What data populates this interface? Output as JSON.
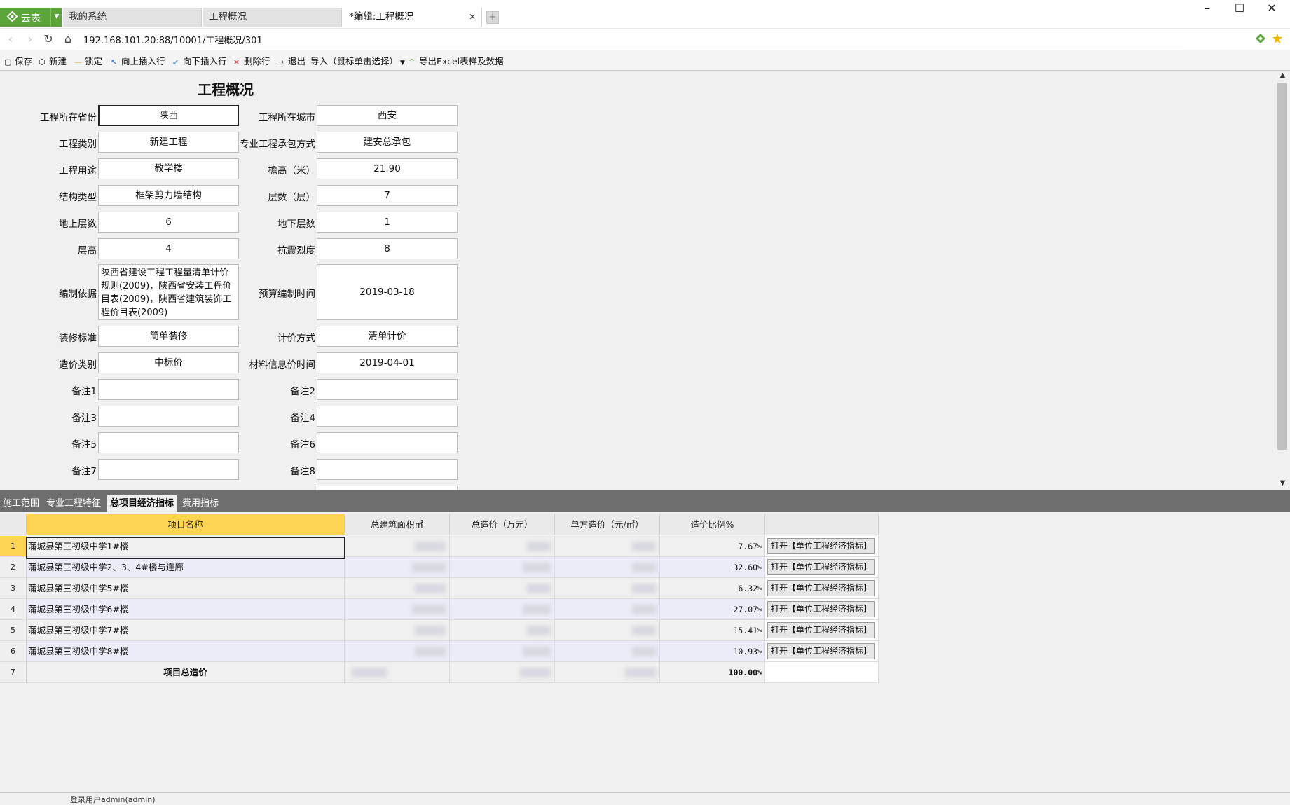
{
  "browser": {
    "brand_label": "云表",
    "tabs": [
      {
        "label": "我的系统"
      },
      {
        "label": "工程概况"
      },
      {
        "label": "*编辑:工程概况"
      }
    ],
    "url": "192.168.101.20:88/10001/工程概况/301"
  },
  "toolbar": {
    "items": [
      {
        "label": "保存"
      },
      {
        "label": "新建"
      },
      {
        "label": "锁定"
      },
      {
        "label": "向上插入行"
      },
      {
        "label": "向下插入行"
      },
      {
        "label": "删除行"
      },
      {
        "label": "退出"
      },
      {
        "label": "导入（鼠标单击选择）"
      },
      {
        "label": "导出Excel表样及数据"
      }
    ]
  },
  "form": {
    "title": "工程概况",
    "fields": {
      "province": {
        "label": "工程所在省份",
        "value": "陕西"
      },
      "city": {
        "label": "工程所在城市",
        "value": "西安"
      },
      "category": {
        "label": "工程类别",
        "value": "新建工程"
      },
      "contract_mode": {
        "label": "专业工程承包方式",
        "value": "建安总承包"
      },
      "usage": {
        "label": "工程用途",
        "value": "教学楼"
      },
      "eave_height": {
        "label": "檐高（米）",
        "value": "21.90"
      },
      "structure": {
        "label": "结构类型",
        "value": "框架剪力墙结构"
      },
      "floors": {
        "label": "层数（层）",
        "value": "7"
      },
      "above_floors": {
        "label": "地上层数",
        "value": "6"
      },
      "below_floors": {
        "label": "地下层数",
        "value": "1"
      },
      "floor_height": {
        "label": "层高",
        "value": "4"
      },
      "seismic": {
        "label": "抗震烈度",
        "value": "8"
      },
      "basis": {
        "label": "编制依据",
        "value": "陕西省建设工程工程量清单计价规则(2009)，陕西省安装工程价目表(2009)，陕西省建筑装饰工程价目表(2009)"
      },
      "budget_time": {
        "label": "预算编制时间",
        "value": "2019-03-18"
      },
      "decoration": {
        "label": "装修标准",
        "value": "简单装修"
      },
      "pricing": {
        "label": "计价方式",
        "value": "清单计价"
      },
      "cost_type": {
        "label": "造价类别",
        "value": "中标价"
      },
      "material_time": {
        "label": "材料信息价时间",
        "value": "2019-04-01"
      },
      "note1": {
        "label": "备注1",
        "value": ""
      },
      "note2": {
        "label": "备注2",
        "value": ""
      },
      "note3": {
        "label": "备注3",
        "value": ""
      },
      "note4": {
        "label": "备注4",
        "value": ""
      },
      "note5": {
        "label": "备注5",
        "value": ""
      },
      "note6": {
        "label": "备注6",
        "value": ""
      },
      "note7": {
        "label": "备注7",
        "value": ""
      },
      "note8": {
        "label": "备注8",
        "value": ""
      }
    }
  },
  "subtabs": [
    {
      "label": "施工范围"
    },
    {
      "label": "专业工程特征"
    },
    {
      "label": "总项目经济指标"
    },
    {
      "label": "费用指标"
    }
  ],
  "grid": {
    "headers": [
      "项目名称",
      "总建筑面积㎡",
      "总造价（万元）",
      "单方造价（元/㎡）",
      "造价比例%"
    ],
    "rows": [
      {
        "num": "1",
        "name": "蒲城县第三初级中学1#楼",
        "ratio": "7.67%",
        "action": "打开【单位工程经济指标】"
      },
      {
        "num": "2",
        "name": "蒲城县第三初级中学2、3、4#楼与连廊",
        "ratio": "32.60%",
        "action": "打开【单位工程经济指标】"
      },
      {
        "num": "3",
        "name": "蒲城县第三初级中学5#楼",
        "ratio": "6.32%",
        "action": "打开【单位工程经济指标】"
      },
      {
        "num": "4",
        "name": "蒲城县第三初级中学6#楼",
        "ratio": "27.07%",
        "action": "打开【单位工程经济指标】"
      },
      {
        "num": "5",
        "name": "蒲城县第三初级中学7#楼",
        "ratio": "15.41%",
        "action": "打开【单位工程经济指标】"
      },
      {
        "num": "6",
        "name": "蒲城县第三初级中学8#楼",
        "ratio": "10.93%",
        "action": "打开【单位工程经济指标】"
      }
    ],
    "total_row": {
      "num": "7",
      "name": "项目总造价",
      "ratio": "100.00%"
    }
  },
  "status": {
    "text": "登录用户admin(admin)"
  },
  "colors": {
    "brand": "#5aa43a",
    "selected_header": "#ffd452",
    "alt_row": "#ececf8",
    "splitter": "#6e6e6e"
  }
}
